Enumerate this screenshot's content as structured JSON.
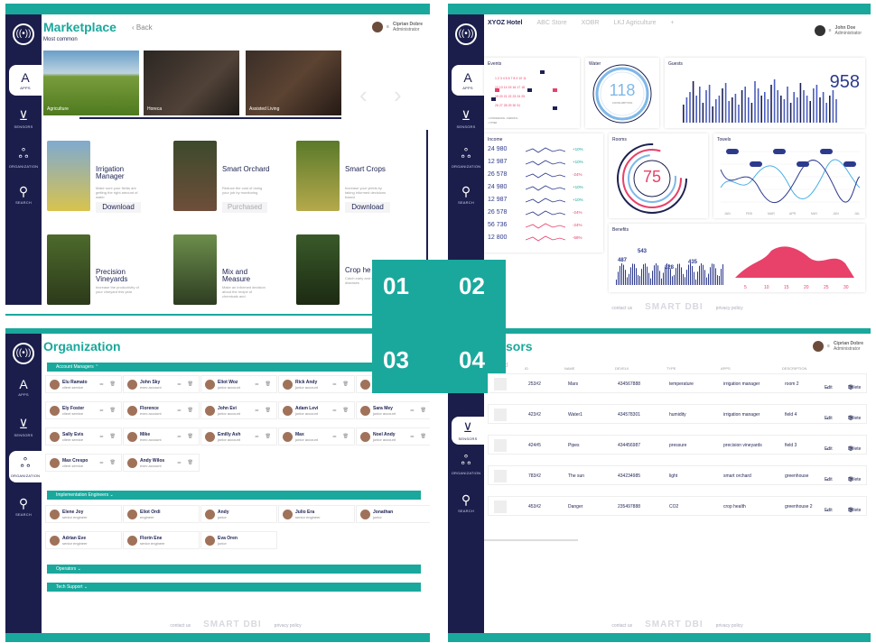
{
  "overlay": {
    "q1": "01",
    "q2": "02",
    "q3": "03",
    "q4": "04"
  },
  "nav": {
    "apps": "APPS",
    "sensors": "SENSORS",
    "organization": "ORGANIZATION",
    "search": "SEARCH"
  },
  "footer": {
    "contact": "contact us",
    "brand": "SMART DBI",
    "privacy": "privacy policy"
  },
  "marketplace": {
    "title": "Marketplace",
    "back": "Back",
    "subtitle": "Most common",
    "user_name": "Ciprian Dobre",
    "user_role": "Administrator",
    "photos": [
      "Agriculture",
      "Horeca",
      "Assisted Living"
    ],
    "apps": [
      {
        "title": "Irrigation Manager",
        "desc": "Make sure your fields are getting the right amount of water",
        "action": "Download"
      },
      {
        "title": "Smart Orchard",
        "desc": "Reduce the cost of doing your job by monitoring",
        "action": "Purchased"
      },
      {
        "title": "Smart Crops",
        "desc": "Increase your yields by taking informed decisions based",
        "action": "Download"
      },
      {
        "title": "Precision Vineyards",
        "desc": "Increase the productivity of your vineyard this year"
      },
      {
        "title": "Mix and Measure",
        "desc": "Make an informed decision about the recipe of chemicals and"
      },
      {
        "title": "Crop he",
        "desc": "Catch early and detect diseases"
      }
    ]
  },
  "hotel": {
    "tabs": [
      "XYOZ Hotel",
      "ABC Store",
      "XOBR",
      "LKJ Agriculture",
      "+"
    ],
    "user_name": "John Doe",
    "user_role": "Administrator",
    "events": "Events",
    "water": "Water",
    "water_value": "118",
    "water_sub": "CONSUMPTION",
    "guests": "Guests",
    "guests_value": "958",
    "income": "Income",
    "income_values": [
      "24 980",
      "12 987",
      "26 578",
      "24 980",
      "12 987",
      "26 578",
      "56 736",
      "12 800"
    ],
    "income_deltas": [
      "+10%",
      "+10%",
      "-24%",
      "+10%",
      "+10%",
      "-24%",
      "-24%",
      "-58%"
    ],
    "rooms": "Rooms",
    "rooms_value": "75",
    "towels": "Towels",
    "towel_axis": [
      "JAN",
      "FEB",
      "MAR",
      "APR",
      "MAY",
      "JUN",
      "JUL"
    ],
    "benefits": "Benefits",
    "benefits_values": [
      "487",
      "543",
      "328",
      "435"
    ],
    "benefit_rank": [
      "5",
      "10",
      "15",
      "20",
      "25",
      "30"
    ]
  },
  "organization": {
    "title": "Organization",
    "sections": [
      "Account Managers",
      "Implementation Engineers",
      "Operators",
      "Tech Support"
    ],
    "account_managers": [
      {
        "name": "Elu Ramato",
        "role": "client service"
      },
      {
        "name": "John Sky",
        "role": "exec account"
      },
      {
        "name": "Eliot Woz",
        "role": "junior account"
      },
      {
        "name": "Rick Andy",
        "role": "junior account"
      },
      {
        "name": "Andr",
        "role": ""
      },
      {
        "name": "Ely Foster",
        "role": "client service"
      },
      {
        "name": "Florence",
        "role": "exec account"
      },
      {
        "name": "John Evi",
        "role": "junior account"
      },
      {
        "name": "Adam Levi",
        "role": "junior account"
      },
      {
        "name": "Sara Mey",
        "role": "junior account"
      },
      {
        "name": "Sally Evis",
        "role": "client service"
      },
      {
        "name": "Mike",
        "role": "exec account"
      },
      {
        "name": "Emilly Ash",
        "role": "junior account"
      },
      {
        "name": "Max",
        "role": "junior account"
      },
      {
        "name": "Noel Andy",
        "role": "junior account"
      },
      {
        "name": "Max Crespo",
        "role": "client service"
      },
      {
        "name": "Andy Wilos",
        "role": "exec account"
      }
    ],
    "engineers": [
      {
        "name": "Elene Joy",
        "role": "senior engineer"
      },
      {
        "name": "Eliot Ordi",
        "role": "engineer"
      },
      {
        "name": "Andy",
        "role": "junior"
      },
      {
        "name": "Julio Era",
        "role": "senior engineer"
      },
      {
        "name": "Jonathan",
        "role": "junior"
      },
      {
        "name": "Adrian Eve",
        "role": "senior engineer"
      },
      {
        "name": "Florin Ene",
        "role": "senior engineer"
      },
      {
        "name": "Eva Oren",
        "role": "junior"
      }
    ]
  },
  "sensors": {
    "title": "Sensors",
    "title_visible": "sors",
    "add_label": "Add",
    "user_name": "Ciprian Dobre",
    "user_role": "Administrator",
    "headers": [
      "ID",
      "NAME",
      "DEVEUI",
      "TYPE",
      "APPS",
      "DESCRIPTION"
    ],
    "rows": [
      {
        "id": "253#2",
        "name": "Mars",
        "deveui": "434567888",
        "type": "temperature",
        "app": "irrigation manager",
        "desc": "room 2"
      },
      {
        "id": "423#2",
        "name": "Water1",
        "deveui": "434578301",
        "type": "humidity",
        "app": "irrigation manager",
        "desc": "field 4"
      },
      {
        "id": "424#5",
        "name": "Pipes",
        "deveui": "434456987",
        "type": "pressure",
        "app": "precision vineyards",
        "desc": "field 3"
      },
      {
        "id": "783#2",
        "name": "The sun",
        "deveui": "434234985",
        "type": "light",
        "app": "smart orchard",
        "desc": "greenhouse"
      },
      {
        "id": "453#2",
        "name": "Danger",
        "deveui": "235497888",
        "type": "CO2",
        "app": "crop health",
        "desc": "greenhouse 2"
      }
    ],
    "edit": "Edit",
    "delete": "Delete"
  }
}
